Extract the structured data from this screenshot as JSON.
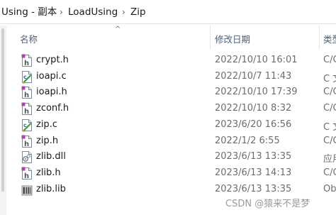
{
  "breadcrumb": {
    "items": [
      "Using - 副本",
      "LoadUsing",
      "Zip"
    ],
    "separator": "›"
  },
  "header": {
    "name": "名称",
    "date": "修改日期",
    "type": "类型",
    "sort_indicator": "^"
  },
  "files": [
    {
      "name": "crypt.h",
      "date": "2022/10/10 16:01",
      "type": "C/C",
      "icon": "header-file-icon"
    },
    {
      "name": "ioapi.c",
      "date": "2022/10/7 11:43",
      "type": "C 文",
      "icon": "c-source-file-icon"
    },
    {
      "name": "ioapi.h",
      "date": "2022/10/10 17:39",
      "type": "C/C",
      "icon": "header-file-icon"
    },
    {
      "name": "zconf.h",
      "date": "2022/10/10 8:32",
      "type": "C/C",
      "icon": "header-file-icon"
    },
    {
      "name": "zip.c",
      "date": "2023/6/20 16:56",
      "type": "C 文",
      "icon": "c-source-file-icon"
    },
    {
      "name": "zip.h",
      "date": "2022/1/2 6:55",
      "type": "C/C",
      "icon": "header-file-icon"
    },
    {
      "name": "zlib.dll",
      "date": "2023/6/13 13:35",
      "type": "应用",
      "icon": "dll-file-icon"
    },
    {
      "name": "zlib.h",
      "date": "2023/6/13 14:13",
      "type": "C/C",
      "icon": "header-file-icon"
    },
    {
      "name": "zlib.lib",
      "date": "2023/6/13 13:35",
      "type": "Obj",
      "icon": "lib-file-icon"
    }
  ],
  "watermark": "CSDN @猿来不是梦",
  "colors": {
    "header_text": "#4c607a",
    "date_text": "#6d6d6d",
    "header_icon_accent": "#b43fb4",
    "c_icon_accent": "#3a9a2a"
  }
}
